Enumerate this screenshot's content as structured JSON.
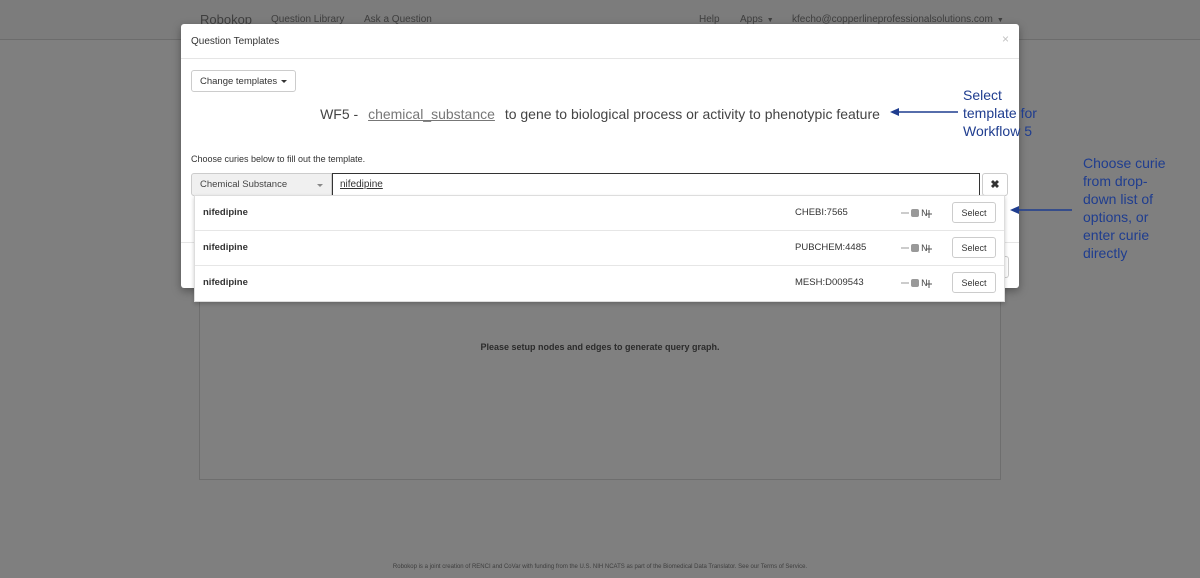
{
  "navbar": {
    "brand": "Robokop",
    "links": [
      "Question Library",
      "Ask a Question"
    ],
    "help": "Help",
    "apps": "Apps",
    "user": "kfecho@copperlineprofessionalsolutions.com"
  },
  "background": {
    "query_graph_message": "Please setup nodes and edges to generate query graph.",
    "footer": "Robokop is a joint creation of RENCI and CoVar with funding from the U.S. NIH NCATS as part of the Biomedical Data Translator. See our Terms of Service."
  },
  "modal": {
    "title": "Question Templates",
    "close_symbol": "×",
    "change_templates_label": "Change templates",
    "template": {
      "prefix": "WF5 -",
      "concept": "chemical_substance",
      "suffix": "to gene to biological process or activity to phenotypic feature"
    },
    "instructions": "Choose curies below to fill out the template.",
    "type_select_value": "Chemical Substance",
    "curie_input_value": "nifedipine",
    "clear_symbol": "✖"
  },
  "dropdown": {
    "options": [
      {
        "name": "nifedipine",
        "curie": "CHEBI:7565",
        "select_label": "Select"
      },
      {
        "name": "nifedipine",
        "curie": "PUBCHEM:4485",
        "select_label": "Select"
      },
      {
        "name": "nifedipine",
        "curie": "MESH:D009543",
        "select_label": "Select"
      }
    ]
  },
  "annotations": {
    "template": "Select template for Workflow 5",
    "curie": "Choose curie from drop-down list of options, or enter curie directly"
  },
  "colors": {
    "annotation": "#1f3d8f",
    "overlay": "#7f7f7f"
  }
}
